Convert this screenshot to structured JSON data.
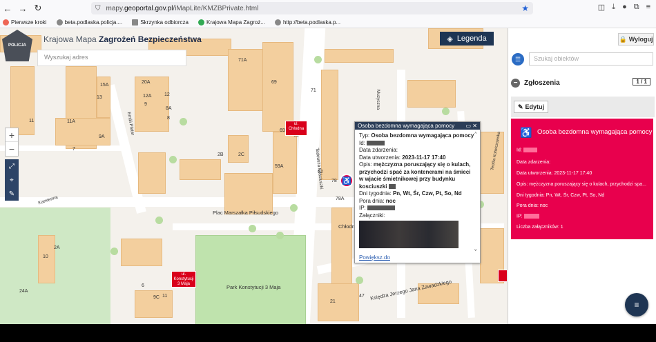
{
  "browser": {
    "url_prefix": "mapy.",
    "url_domain": "geoportal.gov.pl",
    "url_path": "/iMapLite/KMZBPrivate.html",
    "bookmarks": [
      "Pierwsze kroki",
      "beta.podlaska.policja....",
      "Skrzynka odbiorcza",
      "Krajowa Mapa Zagroż...",
      "http://beta.podlaska.p..."
    ]
  },
  "app": {
    "logo_text": "POLICJA",
    "title_light": "Krajowa Mapa ",
    "title_bold": "Zagrożeń Bezpieczeństwa",
    "search_placeholder": "Wyszukaj adres",
    "legend_label": "Legenda"
  },
  "map": {
    "streets": [
      "Plac Marszałka Piłsudskiego",
      "Park Konstytucji 3 Maja",
      "Kamienna",
      "Emilii Plater",
      "Księdza Jerzego Jana Zawadzkiego",
      "Chłodna",
      "Muzyczna",
      "Teofila Kotwiczowska",
      "Tadeusza Kościuszki"
    ],
    "labels": [
      "71A",
      "15A",
      "13",
      "12",
      "20A",
      "12A",
      "9",
      "8A",
      "8",
      "11",
      "11A",
      "7",
      "9A",
      "2B",
      "2C",
      "59A",
      "69A",
      "63",
      "78",
      "62",
      "71",
      "11",
      "6",
      "9C",
      "24A",
      "10",
      "2A",
      "47",
      "21",
      "51",
      "78A",
      "69"
    ],
    "markers": [
      {
        "text": "ul. Chłodna"
      },
      {
        "text": "ul. Konstytucji 3 Maja"
      }
    ]
  },
  "popup": {
    "title": "Osoba bezdomna wymagająca pomocy",
    "typ_label": "Typ:",
    "typ_value": "Osoba bezdomna wymagająca pomocy",
    "id_label": "Id:",
    "data_zdarzenia_label": "Data zdarzenia:",
    "data_utworzenia_label": "Data utworzenia:",
    "data_utworzenia_value": "2023-11-17 17:40",
    "opis_label": "Opis:",
    "opis_value": "mężczyzna poruszający się o kulach, przychodzi spać za kontenerami na śmieci w wjacie śmietnikowej przy budynku kosciuszki",
    "dni_label": "Dni tygodnia:",
    "dni_value": "Pn, Wt, Śr, Czw, Pt, So, Nd",
    "pora_label": "Pora dnia:",
    "pora_value": "noc",
    "ip_label": "IP:",
    "zalaczniki_label": "Załączniki:",
    "link_label": "Powiększ.do"
  },
  "panel": {
    "logout_label": "Wyloguj",
    "search_placeholder": "Szukaj obiektów",
    "section_title": "Zgłoszenia",
    "count": "1 / 1",
    "edit_label": "Edytuj",
    "card": {
      "title": "Osoba bezdomna wymagająca pomocy",
      "id_label": "Id:",
      "data_zdarzenia": "Data zdarzenia:",
      "data_utworzenia": "Data utworzenia: 2023-11-17 17:40",
      "opis": "Opis: mężczyzna poruszający się o kulach, przychodzi spa...",
      "dni": "Dni tygodnia: Pn, Wt, Śr, Czw, Pt, So, Nd",
      "pora": "Pora dnia: noc",
      "ip_label": "IP:",
      "zalaczniki": "Liczba załączników: 1"
    }
  },
  "colors": {
    "accent": "#e8004d",
    "navy": "#1e3553",
    "building": "#f3cf9e",
    "park": "#bfe3ad"
  }
}
